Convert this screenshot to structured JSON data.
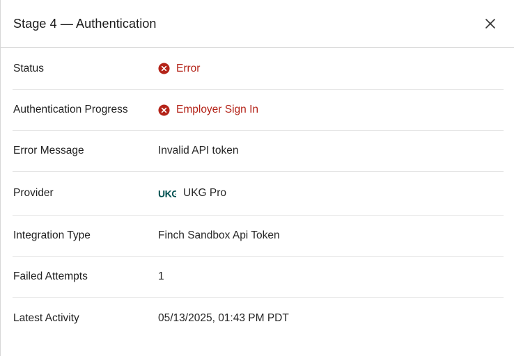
{
  "header": {
    "title": "Stage 4 — Authentication",
    "close_icon": "close-icon"
  },
  "colors": {
    "error": "#b42318",
    "ukg_brand": "#005151"
  },
  "rows": [
    {
      "label": "Status",
      "value": "Error",
      "icon": "error-circle-icon"
    },
    {
      "label": "Authentication Progress",
      "value": "Employer Sign In",
      "icon": "error-circle-icon"
    },
    {
      "label": "Error Message",
      "value": "Invalid API token"
    },
    {
      "label": "Provider",
      "value": "UKG Pro",
      "logo_text": "UKG"
    },
    {
      "label": "Integration Type",
      "value": "Finch Sandbox Api Token"
    },
    {
      "label": "Failed Attempts",
      "value": "1"
    },
    {
      "label": "Latest Activity",
      "value": "05/13/2025, 01:43 PM PDT"
    }
  ]
}
